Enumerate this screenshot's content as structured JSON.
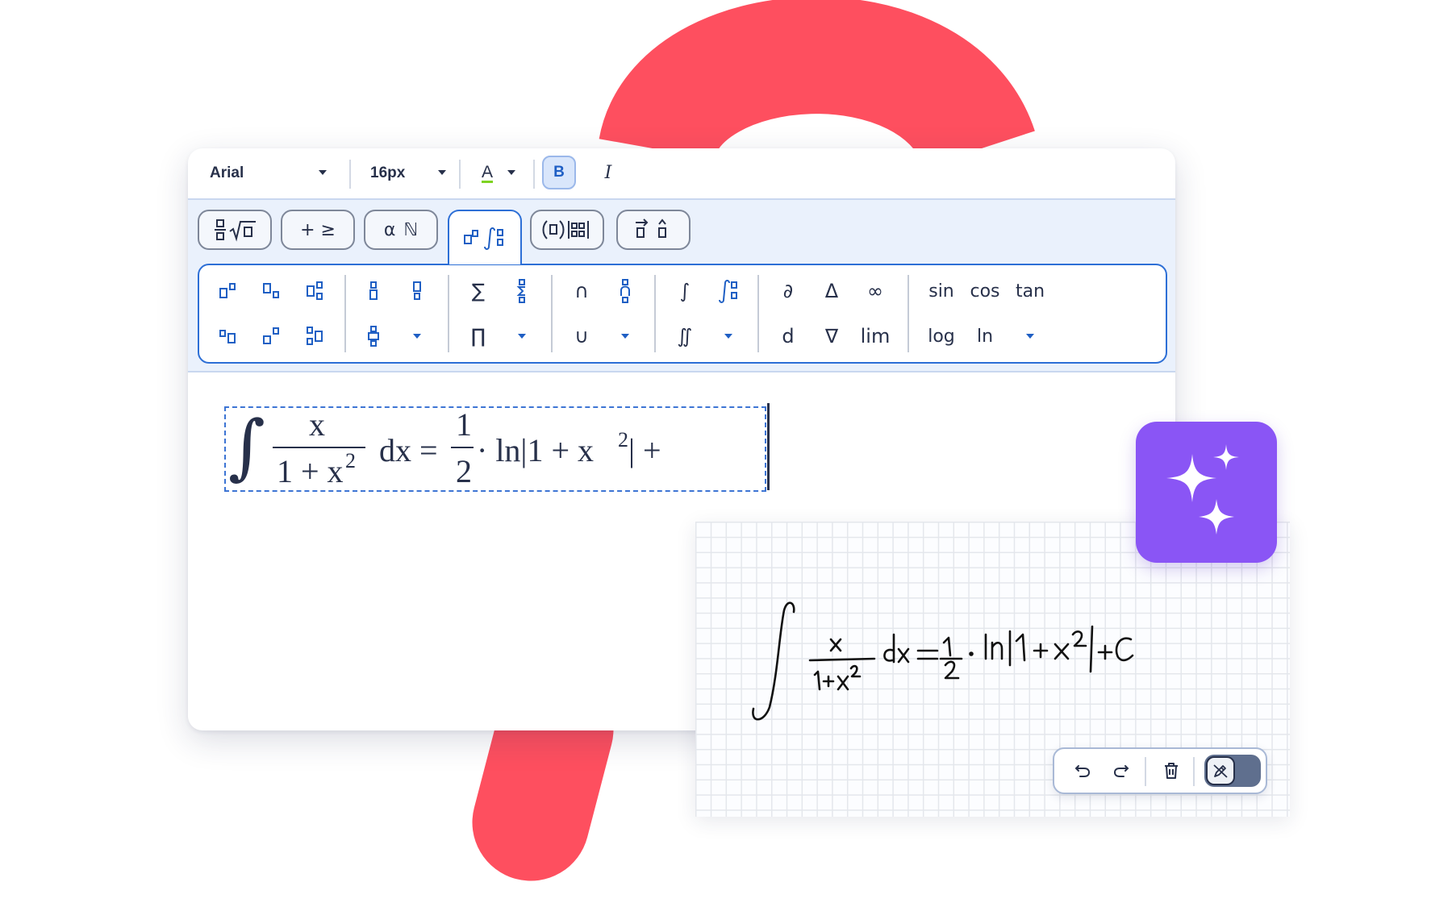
{
  "toolbar": {
    "font_family": "Arial",
    "font_size": "16px",
    "text_color_label": "A",
    "bold_label": "B",
    "italic_label": "I"
  },
  "tabs": [
    {
      "label": "‗√□"
    },
    {
      "label": "+ ≥"
    },
    {
      "label": "α ℕ"
    },
    {
      "label": "□ᵒ ∫□"
    },
    {
      "label": "(□)|□□|"
    },
    {
      "label": "⃗□ ̂□"
    }
  ],
  "symbols": {
    "sum": "∑",
    "product": "∏",
    "intersection": "∩",
    "union": "∪",
    "integral": "∫",
    "double_integral": "∬",
    "partial": "∂",
    "delta": "Δ",
    "infinity": "∞",
    "differential": "d",
    "nabla": "∇",
    "lim": "lim",
    "sin": "sin",
    "cos": "cos",
    "tan": "tan",
    "log": "log",
    "ln": "ln"
  },
  "formula": {
    "integral": "∫",
    "numerator": "x",
    "denominator_base": "1 + x",
    "denominator_exp": "2",
    "dx": "dx =",
    "half_num": "1",
    "half_den": "2",
    "rest_base": "· ln|1 + x",
    "rest_exp": "2",
    "rest_tail": "| +"
  },
  "colors": {
    "accent": "#2d6fd6",
    "hook": "#fe4f5f",
    "ai_badge": "#8a55f5",
    "text": "#27304a"
  },
  "handwriting": {
    "icons": [
      "undo-icon",
      "redo-icon",
      "trash-icon",
      "pen-icon"
    ]
  }
}
